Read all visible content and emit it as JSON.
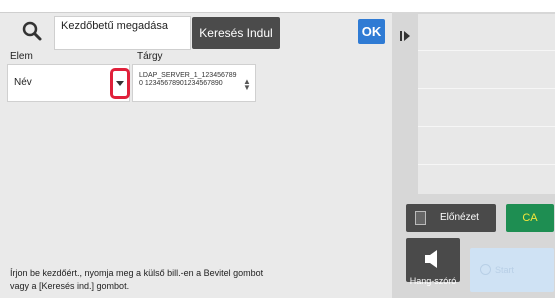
{
  "top": {
    "initial_label": "Kezdőbetű megadása",
    "search_start_label": "Keresés Indul",
    "ok_label": "OK"
  },
  "fields": {
    "elem_label": "Elem",
    "elem_value": "Név",
    "targy_label": "Tárgy",
    "targy_value": "LDAP_SERVER_1_1234567890 12345678901234567890"
  },
  "instruction": "Írjon be kezdőért., nyomja meg a külső bill.-en a Bevitel gombot vagy a [Keresés ind.] gombot.",
  "right": {
    "preview_label": "Előnézet",
    "ca_label": "CA",
    "speaker_label": "Hang-szóró",
    "start_label": "Start"
  },
  "colors": {
    "ok_blue": "#2f7bd4",
    "ca_green": "#1e8e52",
    "highlight_red": "#e0203a",
    "start_blue": "#cfe2f4"
  },
  "icons": [
    "search-icon",
    "chevron-down-icon",
    "spinner-arrows-icon",
    "side-handle-icon",
    "preview-doc-icon",
    "speaker-icon",
    "start-icon"
  ]
}
